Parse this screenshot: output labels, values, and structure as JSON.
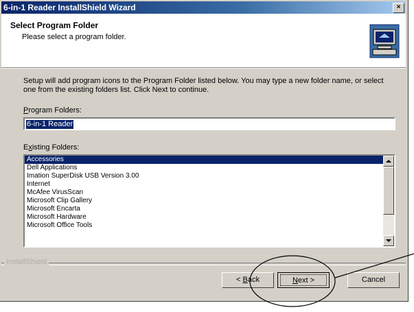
{
  "window": {
    "title": "6-in-1 Reader InstallShield Wizard",
    "close_symbol": "×"
  },
  "header": {
    "title": "Select Program Folder",
    "subtitle": "Please select a program folder."
  },
  "body": {
    "description": "Setup will add program icons to the Program Folder listed below.  You may type a new folder name, or select one from the existing folders list.  Click Next to continue.",
    "program_folders_label_accel": "P",
    "program_folders_label_rest": "rogram Folders:",
    "program_folder_value": "6-in-1 Reader",
    "existing_folders_label_pre": "E",
    "existing_folders_label_accel": "x",
    "existing_folders_label_rest": "isting Folders:"
  },
  "existing_folders": [
    "Accessories",
    "Dell Applications",
    "Imation SuperDisk USB Version 3.00",
    "Internet",
    "McAfee VirusScan",
    "Microsoft Clip Gallery",
    "Microsoft Encarta",
    "Microsoft Hardware",
    "Microsoft Office Tools"
  ],
  "footer": {
    "brand": "InstallShield",
    "back_label_pre": "< ",
    "back_label_accel": "B",
    "back_label_rest": "ack",
    "next_label_accel": "N",
    "next_label_rest": "ext >",
    "cancel_label": "Cancel"
  },
  "icons": {
    "header": "computer-install-icon",
    "scroll_up": "scroll-up-arrow-icon",
    "scroll_down": "scroll-down-arrow-icon"
  },
  "colors": {
    "title_bar": "#0a246a",
    "selection": "#0a246a",
    "dialog_face": "#d4d0c8"
  }
}
